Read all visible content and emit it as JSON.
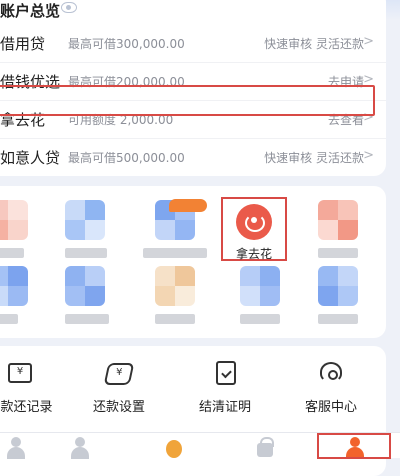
{
  "section_title": "账户总览",
  "loans": [
    {
      "name": "借用贷",
      "limit": "最高可借300,000.00",
      "action": "快速审核 灵活还款"
    },
    {
      "name": "借钱优选",
      "limit": "最高可借200,000.00",
      "action": "去申请"
    },
    {
      "name": "拿去花",
      "limit": "可用额度 2,000.00",
      "action": "去查看"
    },
    {
      "name": "如意人贷",
      "limit": "最高可借500,000.00",
      "action": "快速审核 灵活还款"
    }
  ],
  "featured_app": {
    "label": "拿去花",
    "icon": "flower-wallet-icon"
  },
  "services": [
    {
      "label": "还款还记录",
      "icon": "repayment-record-icon"
    },
    {
      "label": "还款设置",
      "icon": "repayment-settings-icon"
    },
    {
      "label": "结清证明",
      "icon": "settlement-certificate-icon"
    },
    {
      "label": "客服中心",
      "icon": "customer-service-icon"
    }
  ],
  "tabs": [
    {
      "icon": "service-icon"
    },
    {
      "icon": "user-icon"
    },
    {
      "icon": "money-bag-icon"
    },
    {
      "icon": "lock-icon"
    },
    {
      "icon": "profile-icon"
    }
  ],
  "colors": {
    "highlight": "#d84a45",
    "accent": "#f2632c",
    "featured_icon": "#ea5a4a"
  }
}
